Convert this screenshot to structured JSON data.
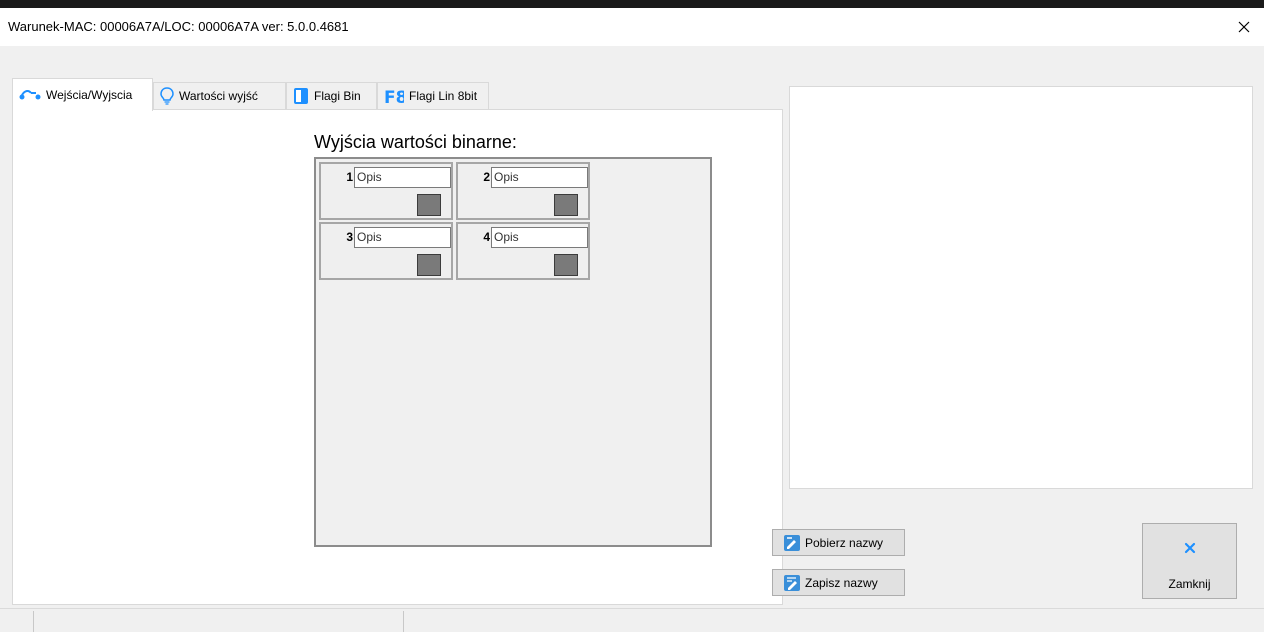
{
  "window": {
    "title": "Warunek-MAC: 00006A7A/LOC: 00006A7A ver: 5.0.0.4681",
    "close_icon": "close-icon"
  },
  "tabs": [
    {
      "label": "Wejścia/Wyjscia",
      "icon": "io-connector-icon",
      "active": true
    },
    {
      "label": "Wartości wyjść",
      "icon": "lightbulb-icon",
      "active": false
    },
    {
      "label": "Flagi Bin",
      "icon": "flag-bin-icon",
      "active": false
    },
    {
      "label": "Flagi Lin 8bit",
      "icon": "f8-icon",
      "active": false
    }
  ],
  "outputs": {
    "heading": "Wyjścia wartości binarne:",
    "items": [
      {
        "number": "1",
        "description": "Opis"
      },
      {
        "number": "2",
        "description": "Opis"
      },
      {
        "number": "3",
        "description": "Opis"
      },
      {
        "number": "4",
        "description": "Opis"
      }
    ]
  },
  "buttons": {
    "fetch_names": "Pobierz nazwy",
    "save_names": "Zapisz nazwy",
    "close": "Zamknij"
  },
  "colors": {
    "accent": "#1e90ff",
    "led_off": "#7a7a7a"
  }
}
